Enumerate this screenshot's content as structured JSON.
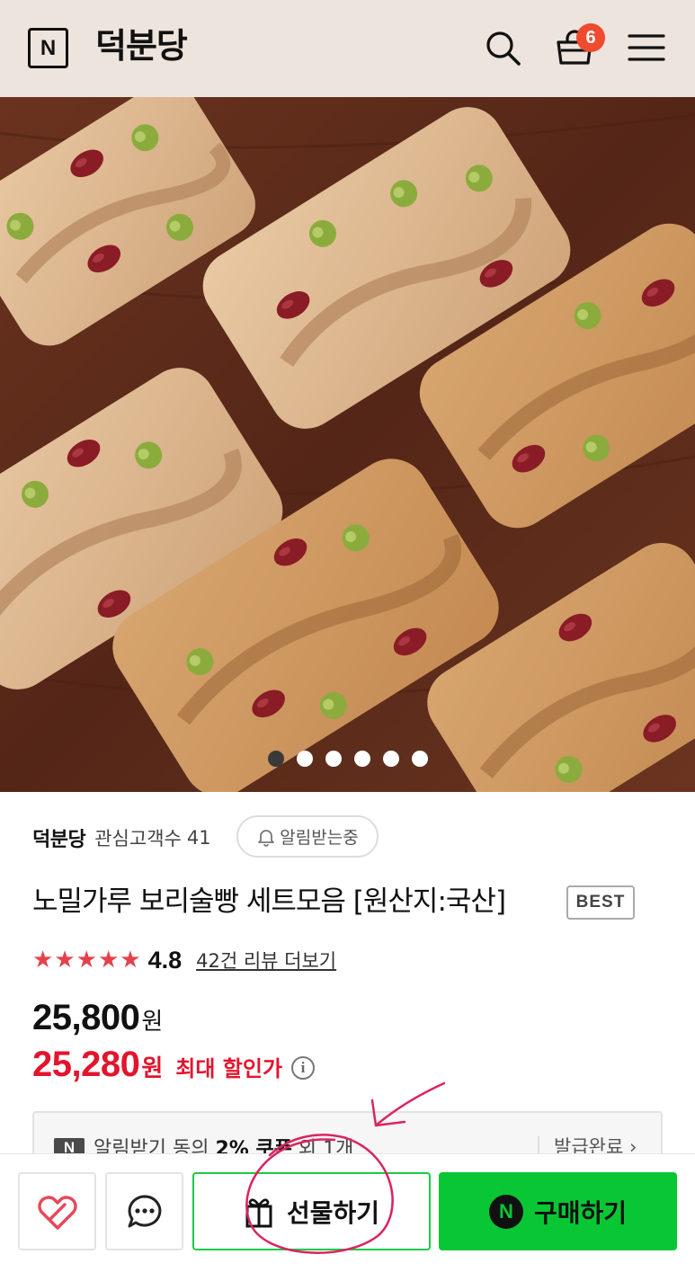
{
  "header": {
    "logo_letter": "N",
    "store_title": "덕분당",
    "cart_count": "6",
    "icons": [
      "search-icon",
      "shopping-bag-icon",
      "menu-icon"
    ],
    "background_color": "#ede4dd"
  },
  "gallery": {
    "image_count": 6,
    "active_index": 0
  },
  "store": {
    "name": "덕분당",
    "followers_label": "관심고객수",
    "followers_count": "41",
    "alert_label": "알림받는중"
  },
  "product": {
    "title": "노밀가루 보리술빵 세트모음 [원산지:국산]",
    "badge": "BEST",
    "rating": "4.8",
    "star_count": 5,
    "review_link": "42건 리뷰 더보기",
    "price": "25,800",
    "price_unit": "원",
    "sale_price": "25,280",
    "sale_unit": "원",
    "sale_label": "최대 할인가",
    "info_icon": "i"
  },
  "coupon": {
    "badge": "N",
    "text_prefix": "알림받기 동의 ",
    "text_bold": "2% 쿠폰",
    "text_suffix": " 외 1개",
    "status": "발급완료 ›"
  },
  "bottom_bar": {
    "gift_label": "선물하기",
    "buy_label": "구매하기",
    "buy_badge": "N",
    "icons": [
      "heart-icon",
      "chat-icon",
      "gift-icon"
    ]
  },
  "colors": {
    "accent_green": "#09c734",
    "sale_red": "#e2152d",
    "star_red": "#e5414c",
    "annotation_pink": "#d9255e"
  }
}
